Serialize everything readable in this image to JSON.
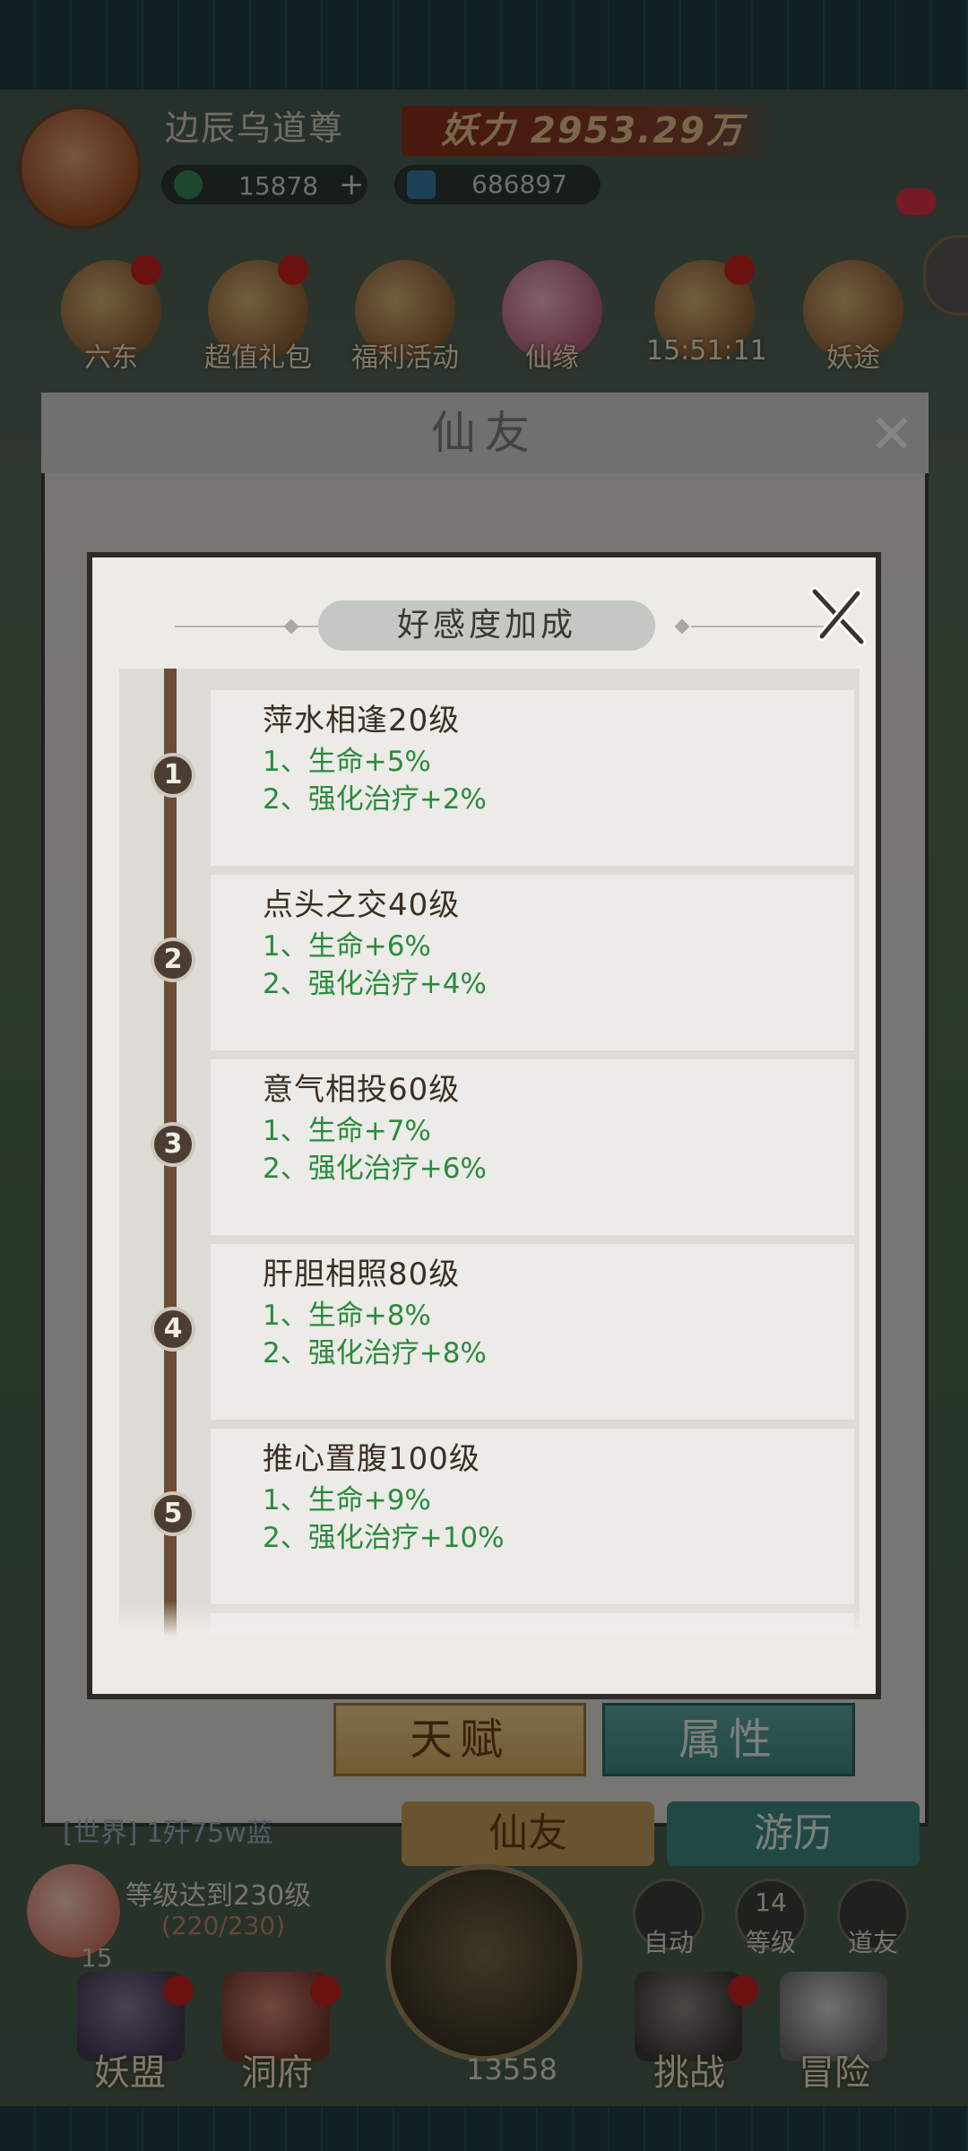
{
  "header": {
    "player_name": "边辰乌道尊",
    "power_label": "妖力",
    "power_value": "2953.29万",
    "currency_jade": "15878",
    "currency_plus": "+",
    "currency_crystal": "686897"
  },
  "top_icons": [
    {
      "label": "六东"
    },
    {
      "label": "超值礼包"
    },
    {
      "label": "福利活动"
    },
    {
      "label": "仙缘"
    },
    {
      "label": "15:51:11"
    },
    {
      "label": "妖途"
    }
  ],
  "back_panel": {
    "title": "仙友"
  },
  "modal": {
    "title": "好感度加成",
    "items": [
      {
        "num": "1",
        "title": "萍水相逢20级",
        "line1": "1、生命+5%",
        "line2": "2、强化治疗+2%"
      },
      {
        "num": "2",
        "title": "点头之交40级",
        "line1": "1、生命+6%",
        "line2": "2、强化治疗+4%"
      },
      {
        "num": "3",
        "title": "意气相投60级",
        "line1": "1、生命+7%",
        "line2": "2、强化治疗+6%"
      },
      {
        "num": "4",
        "title": "肝胆相照80级",
        "line1": "1、生命+8%",
        "line2": "2、强化治疗+8%"
      },
      {
        "num": "5",
        "title": "推心置腹100级",
        "line1": "1、生命+9%",
        "line2": "2、强化治疗+10%"
      }
    ]
  },
  "buttons": {
    "talent": "天赋",
    "attribute": "属性"
  },
  "bottom_tabs": {
    "friends": "仙友",
    "travel": "游历"
  },
  "chat": {
    "text": "[世界] 1歼75w蓝"
  },
  "level": {
    "text": "等级达到230级",
    "progress": "(220/230)",
    "peach_count": "15"
  },
  "right_buttons": [
    {
      "label": "自动"
    },
    {
      "label": "等级",
      "badge": "14"
    },
    {
      "label": "道友"
    }
  ],
  "axe_count": "13558",
  "bottom_nav": [
    {
      "label": "妖盟"
    },
    {
      "label": "洞府"
    },
    {
      "label": "挑战"
    },
    {
      "label": "冒险"
    }
  ]
}
